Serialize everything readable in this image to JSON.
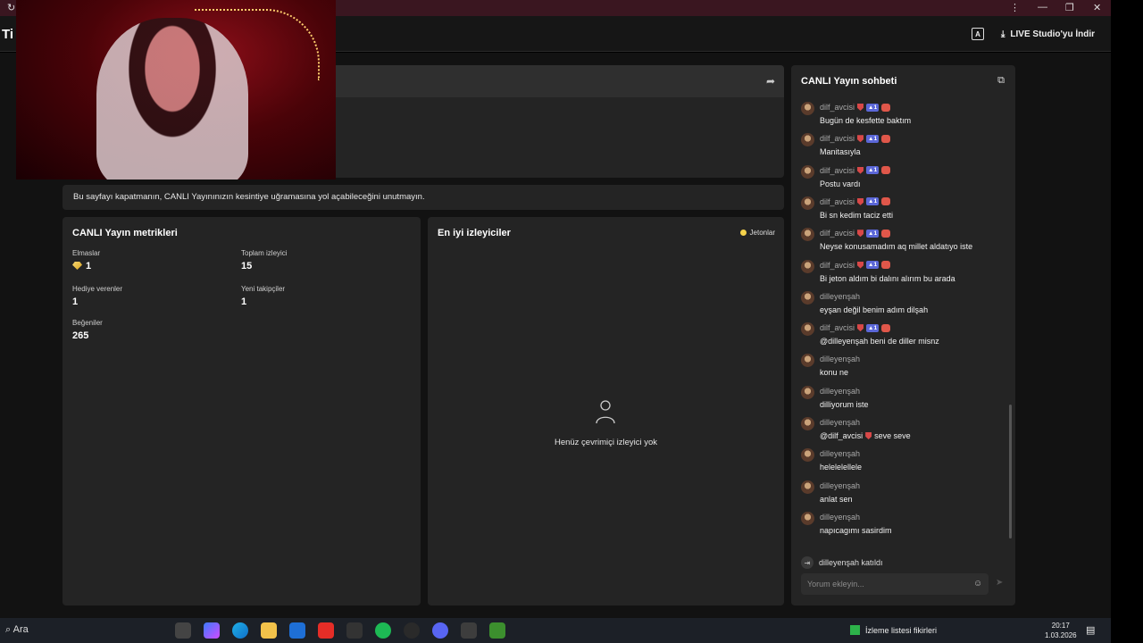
{
  "browser": {
    "refresh_glyph": "↻",
    "menu_glyph": "⋮",
    "minimize_glyph": "—",
    "maximize_glyph": "❐",
    "close_glyph": "✕"
  },
  "header": {
    "brand": "Ti",
    "download_button": "LIVE Studio'yu İndir",
    "accent_icon": "A"
  },
  "notice": "Bu sayfayı kapatmanın, CANLI Yayınınızın kesintiye uğramasına yol açabileceğini unutmayın.",
  "metrics": {
    "title": "CANLI Yayın metrikleri",
    "items": [
      {
        "label": "Elmaslar",
        "value": "1"
      },
      {
        "label": "Toplam izleyici",
        "value": "15"
      },
      {
        "label": "Hediye verenler",
        "value": "1"
      },
      {
        "label": "Yeni takipçiler",
        "value": "1"
      },
      {
        "label": "Beğeniler",
        "value": "265"
      }
    ]
  },
  "viewers": {
    "title": "En iyi izleyiciler",
    "legend": "Jetonlar",
    "legend_color": "#f5d24b",
    "empty_text": "Henüz çevrimiçi izleyici yok"
  },
  "chat": {
    "title": "CANLI Yayın sohbeti",
    "messages": [
      {
        "user": "dilf_avcisi",
        "badges": true,
        "text": "Bugün de kesfette baktım"
      },
      {
        "user": "dilf_avcisi",
        "badges": true,
        "text": "Manitasıyla"
      },
      {
        "user": "dilf_avcisi",
        "badges": true,
        "text": "Postu vardı"
      },
      {
        "user": "dilf_avcisi",
        "badges": true,
        "text": "Bi sn kedim taciz etti"
      },
      {
        "user": "dilf_avcisi",
        "badges": true,
        "text": "Neyse konusamadım aq millet aldatıyo iste"
      },
      {
        "user": "dilf_avcisi",
        "badges": true,
        "text": "Bi jeton aldım bi dalını alırım bu arada"
      },
      {
        "user": "dilleyenşah",
        "badges": false,
        "text": "eyşan değil benim adım dilşah"
      },
      {
        "user": "dilf_avcisi",
        "badges": true,
        "text": "@dilleyenşah beni de diller misnz"
      },
      {
        "user": "dilleyenşah",
        "badges": false,
        "text": "konu ne"
      },
      {
        "user": "dilleyenşah",
        "badges": false,
        "text": "dilliyorum iste"
      },
      {
        "user": "dilleyenşah",
        "badges": false,
        "text": "@dilf_avcisi",
        "text2": "seve seve"
      },
      {
        "user": "dilleyenşah",
        "badges": false,
        "text": "helelelellele"
      },
      {
        "user": "dilleyenşah",
        "badges": false,
        "text": "anlat sen"
      },
      {
        "user": "dilleyenşah",
        "badges": false,
        "text": "napıcagımı sasirdim"
      }
    ],
    "level_badge": "1",
    "joined_user": "dilleyenşah",
    "joined_text": "katıldı",
    "input_placeholder": "Yorum ekleyin..."
  },
  "taskbar": {
    "search": "Ara",
    "tray_text": "İzleme listesi fikirleri",
    "time": "20:17",
    "date": "1.03.2026"
  }
}
